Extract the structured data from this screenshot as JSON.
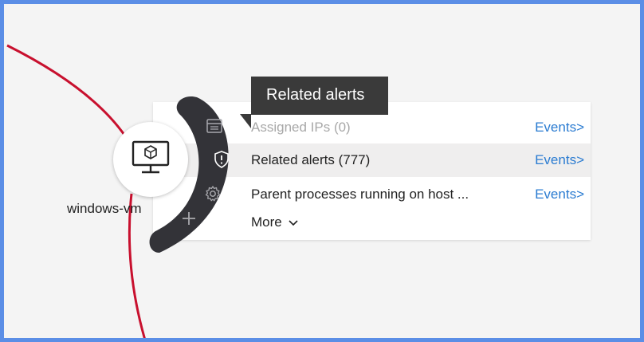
{
  "node": {
    "label": "windows-vm",
    "icon": "virtual-machine-icon"
  },
  "tooltip": {
    "text": "Related alerts"
  },
  "radial_menu": {
    "icons": [
      "network-card-icon",
      "shield-alert-icon",
      "gear-icon",
      "plus-icon"
    ]
  },
  "panel": {
    "rows": [
      {
        "label": "Assigned IPs (0)",
        "link": "Events>",
        "disabled": true
      },
      {
        "label": "Related alerts (777)",
        "link": "Events>",
        "disabled": false
      },
      {
        "label": "Parent processes running on host ...",
        "link": "Events>",
        "disabled": false
      }
    ],
    "more_label": "More"
  },
  "colors": {
    "edge": "#c8102e",
    "menu": "#333338",
    "link": "#2a7bd1",
    "frame": "#5b8ee6"
  }
}
